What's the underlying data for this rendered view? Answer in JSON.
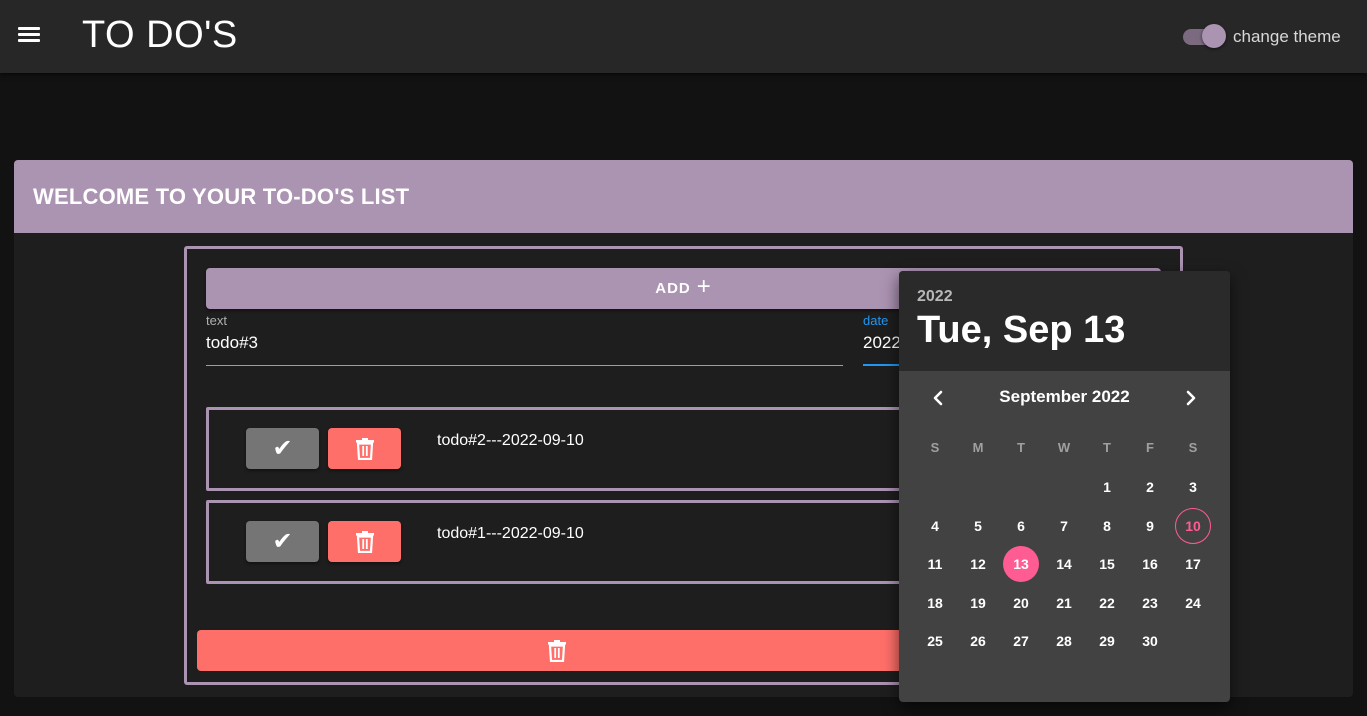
{
  "appbar": {
    "title": "TO DO'S",
    "theme_label": "change theme"
  },
  "card": {
    "title": "WELCOME TO YOUR TO-DO'S LIST"
  },
  "form": {
    "add_label": "ADD",
    "add_icon": "+",
    "text_label": "text",
    "text_value": "todo#3",
    "date_label": "date",
    "date_value": "2022-09-13"
  },
  "todos": [
    {
      "text": "todo#2---2022-09-10",
      "check_icon": "✔"
    },
    {
      "text": "todo#1---2022-09-10",
      "check_icon": "✔"
    }
  ],
  "date_picker": {
    "year": "2022",
    "selected_label": "Tue, Sep 13",
    "month_label": "September 2022",
    "weekdays": [
      "S",
      "M",
      "T",
      "W",
      "T",
      "F",
      "S"
    ],
    "first_weekday_index": 4,
    "days_in_month": 30,
    "selected_day": 13,
    "today_day": 10
  },
  "colors": {
    "accent": "#ab93b2",
    "danger": "#ff6f6a",
    "picker_highlight": "#ff5c93",
    "focus": "#2196f3"
  }
}
